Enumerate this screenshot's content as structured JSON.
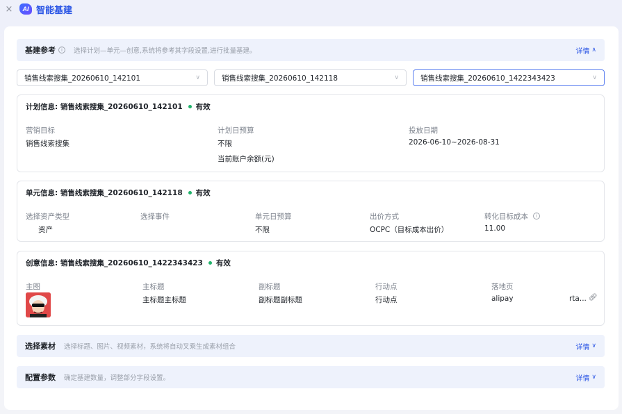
{
  "app": {
    "close_glyph": "×",
    "logo_text": "AI",
    "title": "智能基建"
  },
  "section_reference": {
    "title": "基建参考",
    "hint": "选择计划—单元—创意,系统将参考其字段设置,进行批量基建。",
    "detail_label": "详情",
    "chevron": "∧"
  },
  "selects": [
    {
      "value": "销售线索搜集_20260610_142101"
    },
    {
      "value": "销售线索搜集_20260610_142118"
    },
    {
      "value": "销售线索搜集_20260610_1422343423"
    }
  ],
  "plan_card": {
    "title": "计划信息: 销售线索搜集_20260610_142101",
    "status": "有效",
    "marketing_goal_label": "营销目标",
    "marketing_goal_value": "销售线索搜集",
    "daily_budget_label": "计划日预算",
    "daily_budget_value": "不限",
    "balance_label": "当前账户余额(元)",
    "schedule_label": "投放日期",
    "schedule_value": "2026-06-10~2026-08-31"
  },
  "unit_card": {
    "title": "单元信息: 销售线索搜集_20260610_142118",
    "status": "有效",
    "asset_type_label": "选择资产类型",
    "asset_type_value": "资产",
    "event_label": "选择事件",
    "unit_budget_label": "单元日预算",
    "unit_budget_value": "不限",
    "bid_method_label": "出价方式",
    "bid_method_value": "OCPC（目标成本出价）",
    "target_cost_label": "转化目标成本",
    "target_cost_value": "11.00"
  },
  "creative_card": {
    "title": "创意信息: 销售线索搜集_20260610_1422343423",
    "status": "有效",
    "main_image_label": "主图",
    "main_title_label": "主标题",
    "main_title_value": "主标题主标题",
    "subtitle_label": "副标题",
    "subtitle_value": "副标题副标题",
    "action_label": "行动点",
    "action_value": "行动点",
    "landing_label": "落地页",
    "landing_value_a": "alipay",
    "landing_value_b": "rta..."
  },
  "section_material": {
    "title": "选择素材",
    "hint": "选择标题、图片、视频素材，系统将自动叉乘生成素材组合",
    "detail_label": "详情",
    "chevron": "∨"
  },
  "section_config": {
    "title": "配置参数",
    "hint": "确定基建数量，调整部分字段设置。",
    "detail_label": "详情",
    "chevron": "∨"
  },
  "colors": {
    "accent": "#2a55e5",
    "status_green": "#20b26b",
    "section_bg": "#eef2fc"
  }
}
